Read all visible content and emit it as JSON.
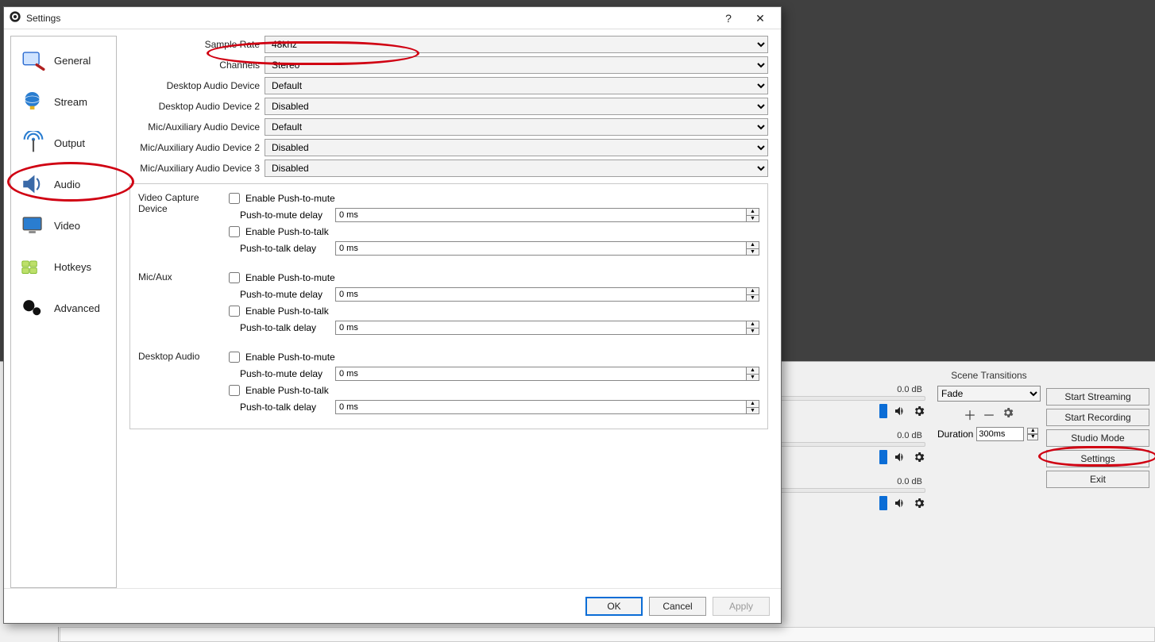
{
  "dialog": {
    "title": "Settings",
    "sidebar": [
      {
        "label": "General"
      },
      {
        "label": "Stream"
      },
      {
        "label": "Output"
      },
      {
        "label": "Audio"
      },
      {
        "label": "Video"
      },
      {
        "label": "Hotkeys"
      },
      {
        "label": "Advanced"
      }
    ],
    "combos": {
      "sample_rate": {
        "label": "Sample Rate",
        "value": "48khz"
      },
      "channels": {
        "label": "Channels",
        "value": "Stereo"
      },
      "desk1": {
        "label": "Desktop Audio Device",
        "value": "Default"
      },
      "desk2": {
        "label": "Desktop Audio Device 2",
        "value": "Disabled"
      },
      "mic1": {
        "label": "Mic/Auxiliary Audio Device",
        "value": "Default"
      },
      "mic2": {
        "label": "Mic/Auxiliary Audio Device 2",
        "value": "Disabled"
      },
      "mic3": {
        "label": "Mic/Auxiliary Audio Device 3",
        "value": "Disabled"
      }
    },
    "push_labels": {
      "enable_mute": "Enable Push-to-mute",
      "mute_delay": "Push-to-mute delay",
      "enable_talk": "Enable Push-to-talk",
      "talk_delay": "Push-to-talk delay",
      "zero_ms": "0 ms"
    },
    "devices": [
      {
        "name": "Video Capture Device"
      },
      {
        "name": "Mic/Aux"
      },
      {
        "name": "Desktop Audio"
      }
    ],
    "buttons": {
      "ok": "OK",
      "cancel": "Cancel",
      "apply": "Apply"
    }
  },
  "mixer": {
    "db": "0.0 dB"
  },
  "scene_trans": {
    "header": "Scene Transitions",
    "fade": "Fade",
    "duration_label": "Duration",
    "duration_value": "300ms"
  },
  "actions": {
    "start_streaming": "Start Streaming",
    "start_recording": "Start Recording",
    "studio_mode": "Studio Mode",
    "settings": "Settings",
    "exit": "Exit"
  }
}
